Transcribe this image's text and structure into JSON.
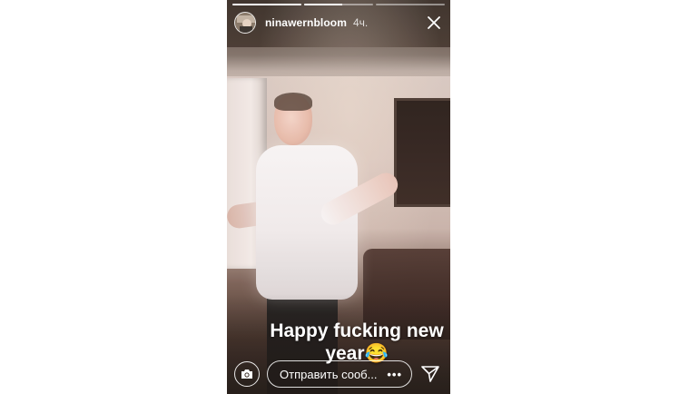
{
  "story": {
    "username": "ninawernbloom",
    "time_ago": "4ч.",
    "progress": [
      1,
      0.55,
      0
    ],
    "caption": "Happy fucking new year😂"
  },
  "footer": {
    "message_placeholder": "Отправить сооб...",
    "more_label": "•••"
  },
  "icons": {
    "close": "close-icon",
    "camera": "camera-icon",
    "send": "send-icon",
    "more": "more-icon"
  },
  "colors": {
    "text": "#ffffff",
    "page_background": "#ffffff"
  }
}
